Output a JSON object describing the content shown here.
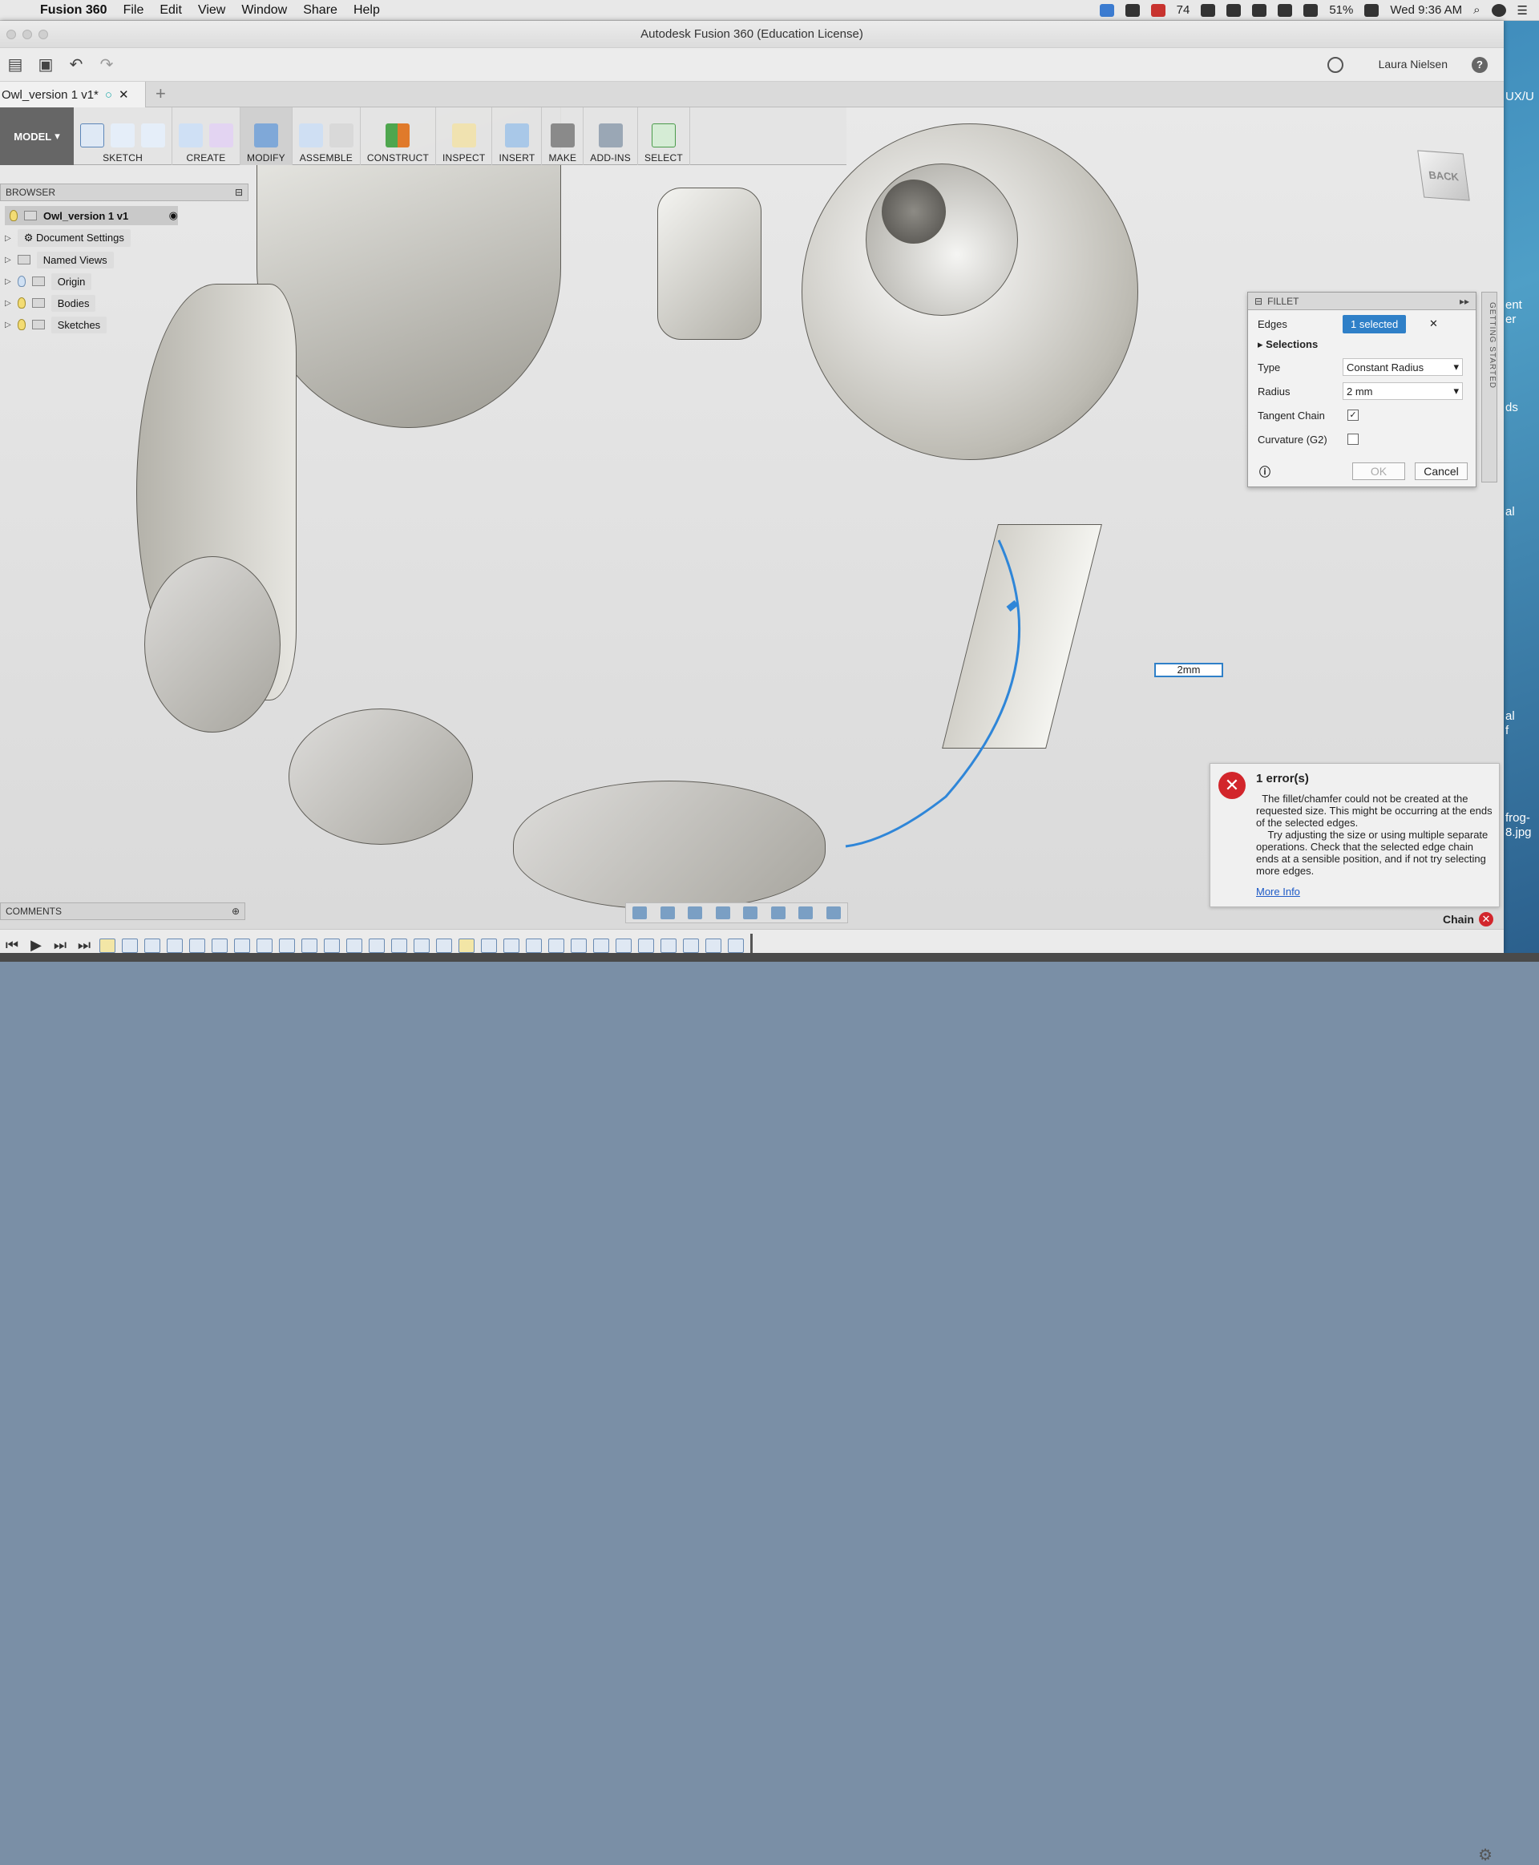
{
  "menubar": {
    "app": "Fusion 360",
    "items": [
      "File",
      "Edit",
      "View",
      "Window",
      "Share",
      "Help"
    ],
    "mail_count": "74",
    "battery": "51%",
    "clock": "Wed 9:36 AM"
  },
  "window": {
    "title": "Autodesk Fusion 360 (Education License)",
    "user": "Laura Nielsen",
    "tab": "Owl_version 1 v1*"
  },
  "toolbar": {
    "workspace": "MODEL",
    "groups": [
      "SKETCH",
      "CREATE",
      "MODIFY",
      "ASSEMBLE",
      "CONSTRUCT",
      "INSPECT",
      "INSERT",
      "MAKE",
      "ADD-INS",
      "SELECT"
    ]
  },
  "browser": {
    "title": "BROWSER",
    "root": "Owl_version 1 v1",
    "nodes": [
      "Document Settings",
      "Named Views",
      "Origin",
      "Bodies",
      "Sketches"
    ]
  },
  "viewcube": {
    "label": "BACK"
  },
  "fillet": {
    "title": "FILLET",
    "edges_label": "Edges",
    "edges_value": "1 selected",
    "selections": "Selections",
    "type_label": "Type",
    "type_value": "Constant Radius",
    "radius_label": "Radius",
    "radius_value": "2 mm",
    "tangent_label": "Tangent Chain",
    "curvature_label": "Curvature (G2)",
    "ok": "OK",
    "cancel": "Cancel"
  },
  "side_tab": "GETTING STARTED",
  "radius_input": "2mm",
  "error": {
    "title": "1 error(s)",
    "message": "  The fillet/chamfer could not be created at the requested size. This might be occurring at the ends of the selected edges.\n    Try adjusting the size or using multiple separate operations. Check that the selected edge chain ends at a sensible position, and if not try selecting more edges.",
    "link": "More Info"
  },
  "chain": "Chain",
  "comments": "COMMENTS",
  "desktop_texts": [
    "UX/U",
    "ent\ner",
    "ds",
    "al",
    "al\nf",
    "frog-\n8.jpg"
  ]
}
